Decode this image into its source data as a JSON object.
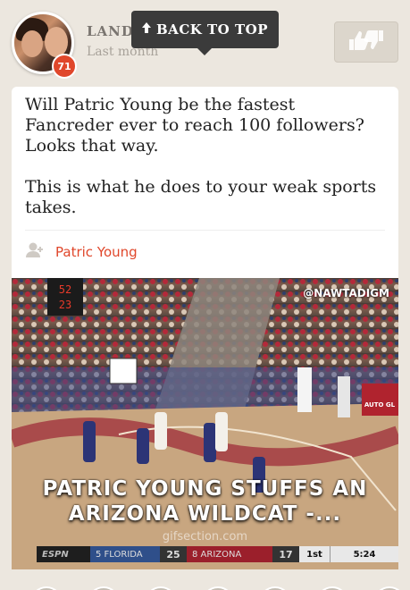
{
  "header": {
    "author_name": "LAND",
    "time_ago": "Last month",
    "badge_count": "71",
    "back_to_top_label": "BACK TO TOP",
    "back_to_top_icon": "arrow-up-icon",
    "vote_icon": "thumbs-up-down-icon"
  },
  "post": {
    "paragraph_1": "Will Patric Young be the fastest Fancreder ever to reach 100 followers? Looks that way.",
    "paragraph_2": "This is what he does to your weak sports takes.",
    "tagged_user_icon": "add-user-icon",
    "tagged_user": "Patric Young"
  },
  "media": {
    "handle_watermark": "@NAWTADIGM",
    "caption": "PATRIC YOUNG STUFFS AN ARIZONA WILDCAT -...",
    "source_watermark": "gifsection.com",
    "scoreboard": {
      "network": "ESPN",
      "team1_label": "5 FLORIDA",
      "team1_score": "25",
      "team2_label": "8 ARIZONA",
      "team2_score": "17",
      "period": "1st",
      "clock": "5:24"
    },
    "arena_clock": "52\n23",
    "sign_text": "AUTO GL"
  },
  "colors": {
    "accent": "#e0472b",
    "background": "#ece7df",
    "tooltip": "#3b3b3b"
  }
}
